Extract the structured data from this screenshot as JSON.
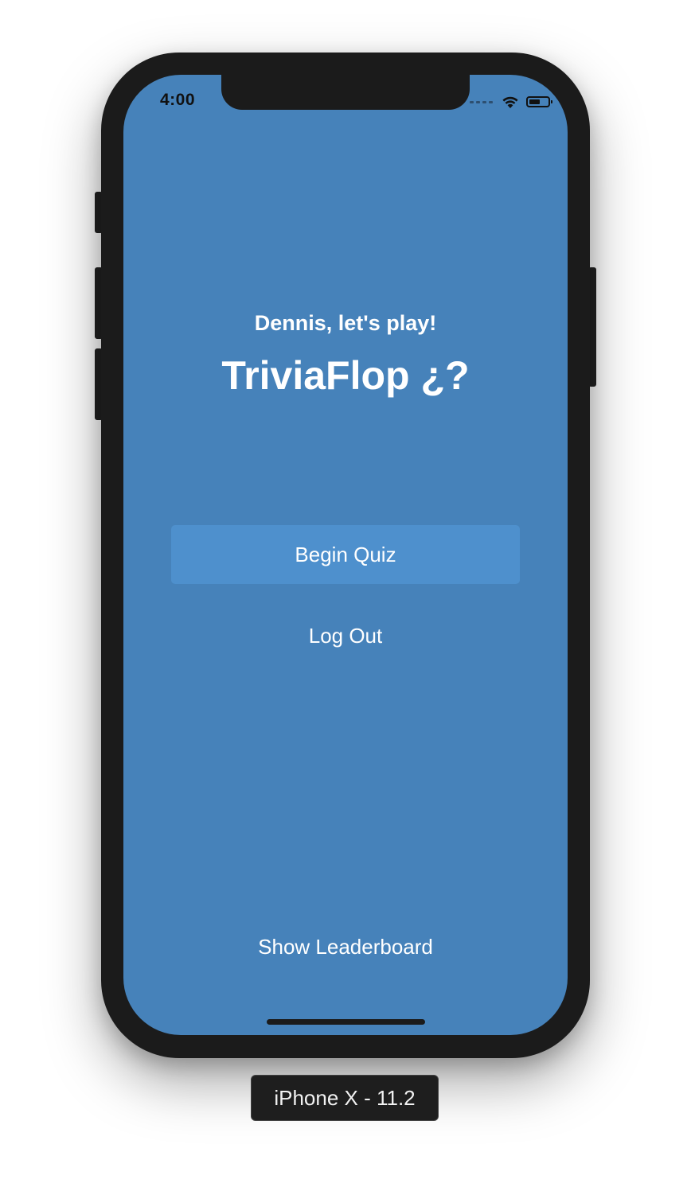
{
  "status_bar": {
    "time": "4:00"
  },
  "screen": {
    "background_color": "#4682BA",
    "greeting": "Dennis, let's play!",
    "title": "TriviaFlop ¿?",
    "begin_button_label": "Begin Quiz",
    "begin_button_color": "#4E90CD",
    "logout_label": "Log Out",
    "leaderboard_label": "Show Leaderboard"
  },
  "simulator": {
    "device_label": "iPhone X - 11.2"
  },
  "icons": [
    "signal-dots-icon",
    "wifi-icon",
    "battery-icon"
  ]
}
